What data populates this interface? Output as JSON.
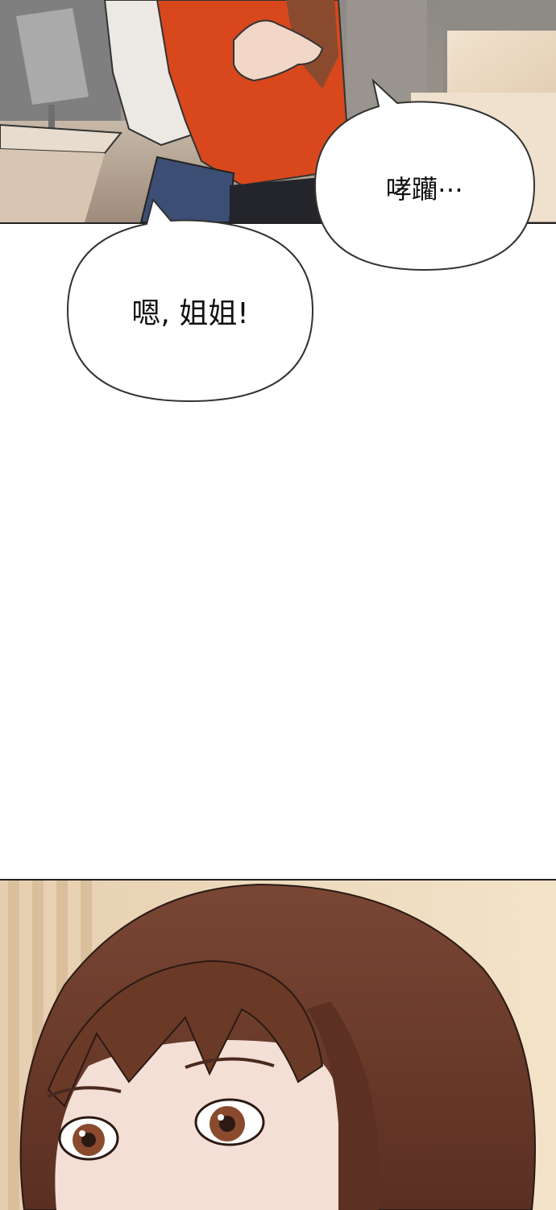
{
  "panels": {
    "top": {
      "scene": "office-embrace"
    },
    "bottom": {
      "scene": "girl-closeup-eyes"
    }
  },
  "bubbles": {
    "right": {
      "text": "哮躪⋯"
    },
    "left": {
      "text": "嗯, 姐姐!"
    }
  },
  "colors": {
    "orange_shirt": "#d8481c",
    "hair_brown": "#6b3a27",
    "skin": "#f2d6c8",
    "office_bg": "#b8a89a",
    "bubble_outline": "#333333"
  }
}
